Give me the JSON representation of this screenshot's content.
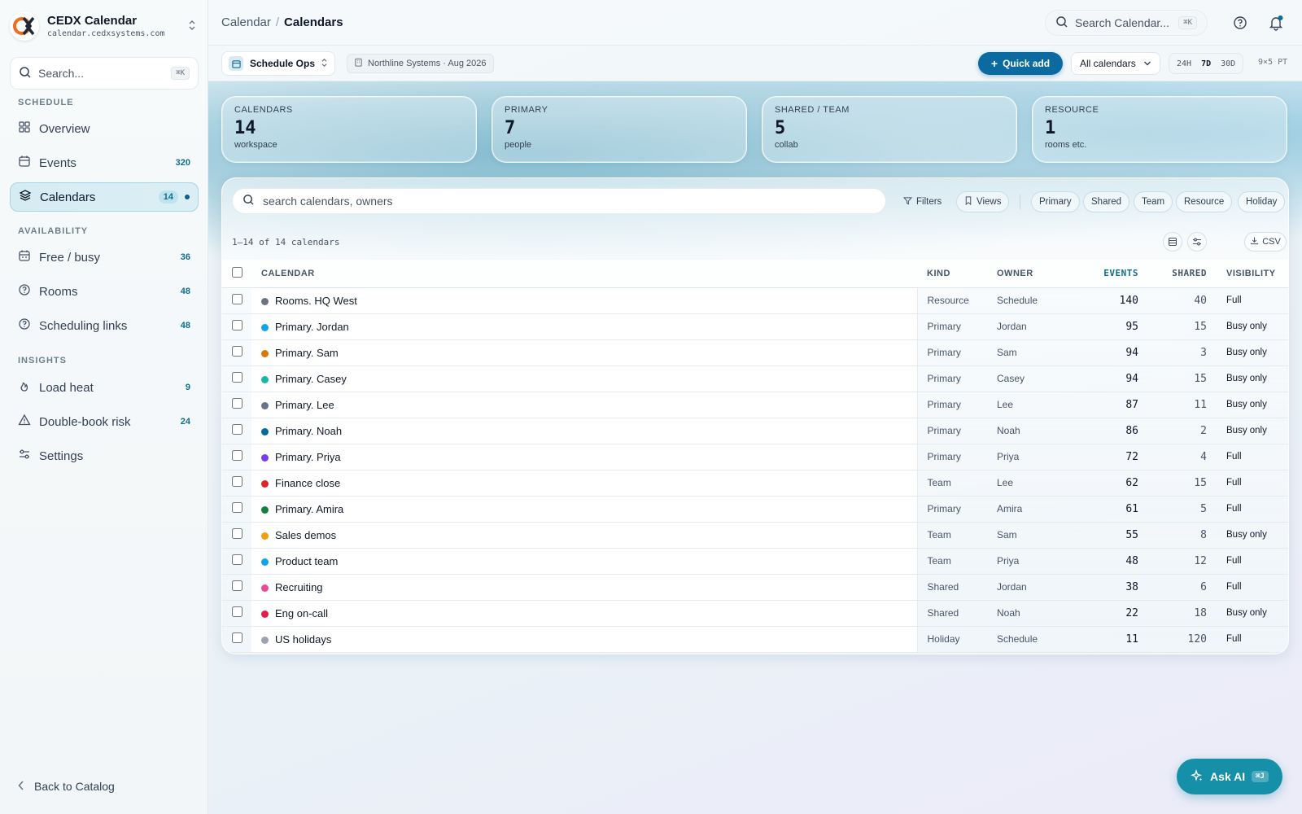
{
  "brand": {
    "title": "CEDX Calendar",
    "url": "calendar.cedxsystems.com"
  },
  "sidebar": {
    "search_placeholder": "Search...",
    "search_kbd": "⌘K",
    "sections": {
      "schedule": "SCHEDULE",
      "availability": "AVAILABILITY",
      "insights": "INSIGHTS"
    },
    "items": [
      {
        "label": "Overview",
        "icon": "grid-icon",
        "count": ""
      },
      {
        "label": "Events",
        "icon": "calendar-icon",
        "count": "320"
      },
      {
        "label": "Calendars",
        "icon": "layers-icon",
        "count": "14",
        "active": true
      },
      {
        "label": "Free / busy",
        "icon": "calendar-clock-icon",
        "count": "36"
      },
      {
        "label": "Rooms",
        "icon": "help-circle-icon",
        "count": "48"
      },
      {
        "label": "Scheduling links",
        "icon": "help-circle-icon",
        "count": "48"
      },
      {
        "label": "Load heat",
        "icon": "flame-icon",
        "count": "9"
      },
      {
        "label": "Double-book risk",
        "icon": "warning-icon",
        "count": "24"
      },
      {
        "label": "Settings",
        "icon": "sliders-icon",
        "count": ""
      }
    ],
    "back_label": "Back to Catalog"
  },
  "topbar": {
    "crumb_parent": "Calendar",
    "crumb_sep": "/",
    "crumb_current": "Calendars",
    "search_placeholder": "Search Calendar...",
    "search_kbd": "⌘K"
  },
  "subbar": {
    "workspace": "Schedule Ops",
    "org": "Northline Systems · Aug 2026",
    "quick_add": "Quick add",
    "calendar_filter": "All calendars",
    "ranges": [
      "24H",
      "7D",
      "30D"
    ],
    "active_range": "7D",
    "timezone": "9×5 PT"
  },
  "stats": [
    {
      "label": "CALENDARS",
      "value": "14",
      "sub": "workspace"
    },
    {
      "label": "PRIMARY",
      "value": "7",
      "sub": "people"
    },
    {
      "label": "SHARED / TEAM",
      "value": "5",
      "sub": "collab"
    },
    {
      "label": "RESOURCE",
      "value": "1",
      "sub": "rooms etc."
    }
  ],
  "table": {
    "search_placeholder": "search calendars, owners",
    "filters_label": "Filters",
    "views_label": "Views",
    "chips": [
      "Primary",
      "Shared",
      "Team",
      "Resource",
      "Holiday"
    ],
    "count_text": "1–14 of 14 calendars",
    "csv_label": "CSV",
    "headers": {
      "calendar": "CALENDAR",
      "kind": "KIND",
      "owner": "OWNER",
      "events": "EVENTS",
      "shared": "SHARED",
      "visibility": "VISIBILITY"
    },
    "rows": [
      {
        "name": "Rooms. HQ West",
        "color": "#6b7280",
        "kind": "Resource",
        "owner": "Schedule",
        "events": "140",
        "shared": "40",
        "visibility": "Full"
      },
      {
        "name": "Primary. Jordan",
        "color": "#0ea5e9",
        "kind": "Primary",
        "owner": "Jordan",
        "events": "95",
        "shared": "15",
        "visibility": "Busy only"
      },
      {
        "name": "Primary. Sam",
        "color": "#d97706",
        "kind": "Primary",
        "owner": "Sam",
        "events": "94",
        "shared": "3",
        "visibility": "Busy only"
      },
      {
        "name": "Primary. Casey",
        "color": "#14b8a6",
        "kind": "Primary",
        "owner": "Casey",
        "events": "94",
        "shared": "15",
        "visibility": "Busy only"
      },
      {
        "name": "Primary. Lee",
        "color": "#64748b",
        "kind": "Primary",
        "owner": "Lee",
        "events": "87",
        "shared": "11",
        "visibility": "Busy only"
      },
      {
        "name": "Primary. Noah",
        "color": "#0369a1",
        "kind": "Primary",
        "owner": "Noah",
        "events": "86",
        "shared": "2",
        "visibility": "Busy only"
      },
      {
        "name": "Primary. Priya",
        "color": "#7c3aed",
        "kind": "Primary",
        "owner": "Priya",
        "events": "72",
        "shared": "4",
        "visibility": "Full"
      },
      {
        "name": "Finance close",
        "color": "#dc2626",
        "kind": "Team",
        "owner": "Lee",
        "events": "62",
        "shared": "15",
        "visibility": "Full"
      },
      {
        "name": "Primary. Amira",
        "color": "#15803d",
        "kind": "Primary",
        "owner": "Amira",
        "events": "61",
        "shared": "5",
        "visibility": "Full"
      },
      {
        "name": "Sales demos",
        "color": "#f59e0b",
        "kind": "Team",
        "owner": "Sam",
        "events": "55",
        "shared": "8",
        "visibility": "Busy only"
      },
      {
        "name": "Product team",
        "color": "#0ea5e9",
        "kind": "Team",
        "owner": "Priya",
        "events": "48",
        "shared": "12",
        "visibility": "Full"
      },
      {
        "name": "Recruiting",
        "color": "#ec4899",
        "kind": "Shared",
        "owner": "Jordan",
        "events": "38",
        "shared": "6",
        "visibility": "Full"
      },
      {
        "name": "Eng on-call",
        "color": "#e11d48",
        "kind": "Shared",
        "owner": "Noah",
        "events": "22",
        "shared": "18",
        "visibility": "Busy only"
      },
      {
        "name": "US holidays",
        "color": "#9ca3af",
        "kind": "Holiday",
        "owner": "Schedule",
        "events": "11",
        "shared": "120",
        "visibility": "Full"
      }
    ]
  },
  "ask_ai": {
    "label": "Ask AI",
    "kbd": "⌘J"
  },
  "colors": {
    "accent": "#0b6aa0",
    "teal": "#1590a8",
    "active_nav": "#d6ecf3"
  }
}
